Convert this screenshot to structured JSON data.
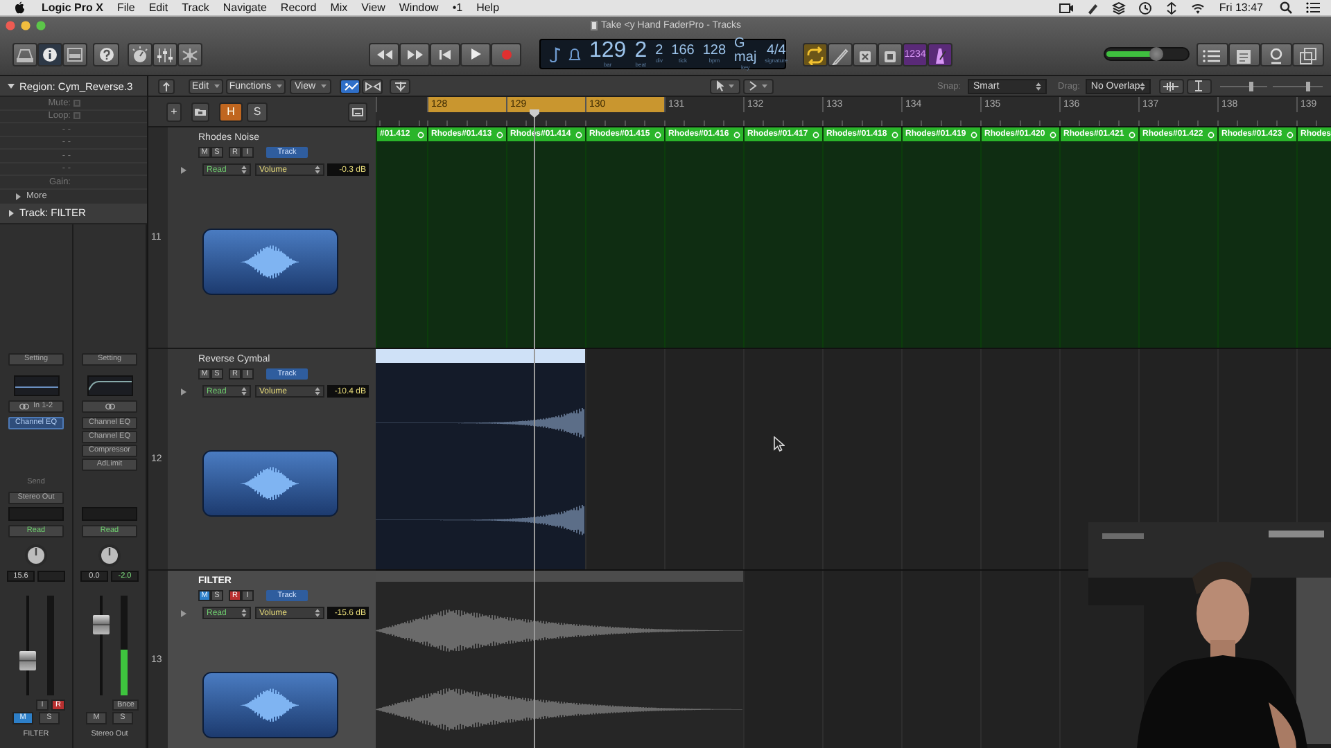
{
  "menu_bar": {
    "app": "Logic Pro X",
    "menus": [
      "File",
      "Edit",
      "Track",
      "Navigate",
      "Record",
      "Mix",
      "View",
      "Window",
      "•1",
      "Help"
    ],
    "clock": "Fri 13:47"
  },
  "window": {
    "title": "Take <y Hand FaderPro - Tracks"
  },
  "control_bar": {
    "view_buttons": [
      {
        "kind": "library",
        "on": false
      },
      {
        "kind": "inspector",
        "on": true
      },
      {
        "kind": "toolbar",
        "on": false
      },
      {
        "kind": "help",
        "on": false
      },
      {
        "kind": "smart-controls",
        "on": false
      },
      {
        "kind": "mixer",
        "on": false
      },
      {
        "kind": "editors",
        "on": false
      }
    ],
    "transport": [
      {
        "kind": "rewind"
      },
      {
        "kind": "forward"
      },
      {
        "kind": "to-start"
      },
      {
        "kind": "play"
      },
      {
        "kind": "record"
      }
    ],
    "lcd": [
      {
        "kind": "big",
        "value": "129",
        "label": "bar"
      },
      {
        "kind": "big",
        "value": "2",
        "label": "beat"
      },
      {
        "kind": "small",
        "value": "2",
        "label": "div"
      },
      {
        "kind": "small",
        "value": "166",
        "label": "tick"
      },
      {
        "kind": "small",
        "value": "128",
        "label": "bpm"
      },
      {
        "kind": "small",
        "value": "G maj",
        "label": "key"
      },
      {
        "kind": "small",
        "value": "4/4",
        "label": "signature"
      }
    ],
    "modes": [
      {
        "kind": "cycle",
        "on": true
      },
      {
        "kind": "pencil",
        "on": false
      },
      {
        "kind": "cross",
        "on": false
      },
      {
        "kind": "square",
        "on": false
      },
      {
        "kind": "count-in",
        "text": "1234",
        "on": true
      },
      {
        "kind": "metronome",
        "on": true
      }
    ],
    "master_volume": {
      "level": 0.62
    },
    "window_buttons": [
      {
        "kind": "list"
      },
      {
        "kind": "note-pad"
      },
      {
        "kind": "loops"
      },
      {
        "kind": "browser"
      }
    ]
  },
  "track_toolbar": {
    "menus": [
      "Edit",
      "Functions",
      "View"
    ],
    "tools": [
      {
        "kind": "catch",
        "on": true
      },
      {
        "kind": "flex",
        "on": false
      },
      {
        "kind": "split",
        "on": false
      }
    ],
    "snap_label": "Snap:",
    "snap": "Smart",
    "drag_label": "Drag:",
    "drag": "No Overlap",
    "zoom_sliders": [
      {
        "level": 0.65
      },
      {
        "level": 0.7
      }
    ]
  },
  "header_toolbar": [
    {
      "kind": "add",
      "text": "+"
    },
    {
      "kind": "folder"
    },
    {
      "kind": "hide",
      "text": "H",
      "on": true
    },
    {
      "kind": "solo",
      "text": "S",
      "on": false
    },
    {
      "kind": "display"
    }
  ],
  "ruler": [
    {
      "label": "128",
      "cycle": true
    },
    {
      "label": "129",
      "cycle": true
    },
    {
      "label": "130",
      "cycle": true
    },
    {
      "label": "131",
      "cycle": false
    },
    {
      "label": "132",
      "cycle": false
    },
    {
      "label": "133",
      "cycle": false
    },
    {
      "label": "134",
      "cycle": false
    },
    {
      "label": "135",
      "cycle": false
    },
    {
      "label": "136",
      "cycle": false
    },
    {
      "label": "137",
      "cycle": false
    },
    {
      "label": "138",
      "cycle": false
    },
    {
      "label": "139",
      "cycle": false
    }
  ],
  "inspector": {
    "region": {
      "title": "Region: Cym_Reverse.3",
      "expanded": true,
      "params": [
        {
          "kind": "checkbox",
          "label": "Mute:",
          "checked": false
        },
        {
          "kind": "checkbox",
          "label": "Loop:",
          "checked": false
        },
        {
          "kind": "value",
          "value": "- -"
        },
        {
          "kind": "value",
          "value": "- -"
        },
        {
          "kind": "value",
          "value": "- -"
        },
        {
          "kind": "value",
          "value": "- -"
        },
        {
          "kind": "label",
          "label": "Gain:"
        }
      ],
      "more": "More",
      "more_expanded": false
    },
    "track": {
      "title": "Track: FILTER",
      "expanded": false
    }
  },
  "strips": [
    {
      "name": "FILTER",
      "setting": "Setting",
      "input": "In 1-2",
      "plugins": [
        {
          "name": "Channel EQ",
          "selected": true
        }
      ],
      "send": "Send",
      "output": "Stereo Out",
      "automation": "Read",
      "volume": "15.6",
      "fader": {
        "level": 0.3
      },
      "buttons": [
        {
          "kind": "input",
          "text": "I",
          "on": false
        },
        {
          "kind": "record",
          "text": "R",
          "on": true
        },
        {
          "kind": "mute",
          "text": "M",
          "on": true
        },
        {
          "kind": "solo",
          "text": "S",
          "on": false
        }
      ]
    },
    {
      "name": "Stereo Out",
      "setting": "Setting",
      "plugins": [
        {
          "name": "Channel EQ",
          "selected": false
        },
        {
          "name": "Channel EQ",
          "selected": false
        },
        {
          "name": "Compressor",
          "selected": false
        },
        {
          "name": "AdLimit",
          "selected": false
        }
      ],
      "automation": "Read",
      "volume": "0.0",
      "peak": "-2.0",
      "fader": {
        "level": 0.75
      },
      "meter": {
        "level": 0.45
      },
      "buttons": [
        {
          "kind": "bounce",
          "text": "Bnce",
          "on": false
        },
        {
          "kind": "mute",
          "text": "M",
          "on": false
        },
        {
          "kind": "solo",
          "text": "S",
          "on": false
        }
      ]
    }
  ],
  "tracks": [
    {
      "number": "11",
      "name": "Rhodes Noise",
      "selected": false,
      "buttons": [
        {
          "kind": "mute",
          "text": "M",
          "on": false
        },
        {
          "kind": "solo",
          "text": "S",
          "on": false
        },
        {
          "kind": "record",
          "text": "R",
          "on": false
        },
        {
          "kind": "input",
          "text": "I",
          "on": false
        }
      ],
      "track_button": "Track",
      "automation": "Read",
      "parameter": "Volume",
      "value": "-0.3 dB",
      "regions": [
        {
          "kind": "midi",
          "name": "#01.412",
          "loop": true
        },
        {
          "kind": "midi",
          "name": "Rhodes#01.413",
          "loop": true
        },
        {
          "kind": "midi",
          "name": "Rhodes#01.414",
          "loop": true
        },
        {
          "kind": "midi",
          "name": "Rhodes#01.415",
          "loop": true
        },
        {
          "kind": "midi",
          "name": "Rhodes#01.416",
          "loop": true
        },
        {
          "kind": "midi",
          "name": "Rhodes#01.417",
          "loop": true
        },
        {
          "kind": "midi",
          "name": "Rhodes#01.418",
          "loop": true
        },
        {
          "kind": "midi",
          "name": "Rhodes#01.419",
          "loop": true
        },
        {
          "kind": "midi",
          "name": "Rhodes#01.420",
          "loop": true
        },
        {
          "kind": "midi",
          "name": "Rhodes#01.421",
          "loop": true
        },
        {
          "kind": "midi",
          "name": "Rhodes#01.422",
          "loop": true
        },
        {
          "kind": "midi",
          "name": "Rhodes#01.423",
          "loop": true
        },
        {
          "kind": "midi",
          "name": "Rhodes"
        }
      ]
    },
    {
      "number": "12",
      "name": "Reverse Cymbal",
      "selected": false,
      "buttons": [
        {
          "kind": "mute",
          "text": "M",
          "on": false
        },
        {
          "kind": "solo",
          "text": "S",
          "on": false
        },
        {
          "kind": "record",
          "text": "R",
          "on": false
        },
        {
          "kind": "input",
          "text": "I",
          "on": false
        }
      ],
      "track_button": "Track",
      "automation": "Read",
      "parameter": "Volume",
      "value": "-10.4 dB",
      "regions": [
        {
          "kind": "audio",
          "selected": true
        }
      ]
    },
    {
      "number": "13",
      "name": "FILTER",
      "selected": true,
      "buttons": [
        {
          "kind": "mute",
          "text": "M",
          "on": true
        },
        {
          "kind": "solo",
          "text": "S",
          "on": false
        },
        {
          "kind": "record",
          "text": "R",
          "on": true
        },
        {
          "kind": "input",
          "text": "I",
          "on": false
        }
      ],
      "track_button": "Track",
      "automation": "Read",
      "parameter": "Volume",
      "value": "-15.6 dB",
      "regions": [
        {
          "kind": "audio",
          "selected": false
        }
      ]
    }
  ]
}
